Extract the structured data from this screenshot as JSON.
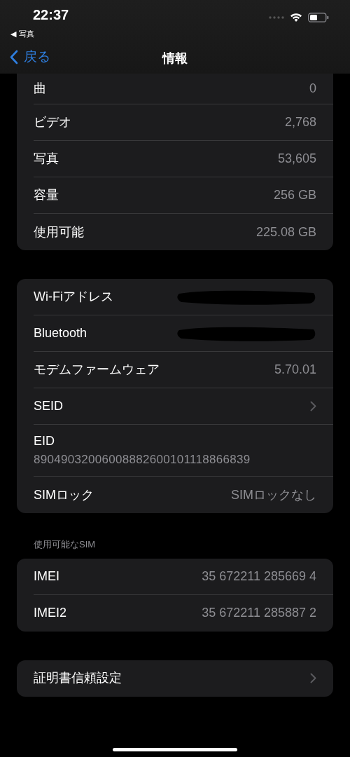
{
  "status_bar": {
    "time": "22:37",
    "back_app": "◀ 写真"
  },
  "nav": {
    "back": "戻る",
    "title": "情報"
  },
  "groups": [
    {
      "rows": [
        {
          "kind": "value",
          "label": "曲",
          "value": "0"
        },
        {
          "kind": "value",
          "label": "ビデオ",
          "value": "2,768"
        },
        {
          "kind": "value",
          "label": "写真",
          "value": "53,605"
        },
        {
          "kind": "value",
          "label": "容量",
          "value": "256 GB"
        },
        {
          "kind": "value",
          "label": "使用可能",
          "value": "225.08 GB"
        }
      ]
    },
    {
      "rows": [
        {
          "kind": "redacted",
          "label": "Wi-Fiアドレス"
        },
        {
          "kind": "redacted",
          "label": "Bluetooth"
        },
        {
          "kind": "value",
          "label": "モデムファームウェア",
          "value": "5.70.01"
        },
        {
          "kind": "link",
          "label": "SEID"
        },
        {
          "kind": "stacked",
          "label": "EID",
          "value": "89049032006008882600101118866839"
        },
        {
          "kind": "value",
          "label": "SIMロック",
          "value": "SIMロックなし"
        }
      ]
    },
    {
      "header": "使用可能なSIM",
      "rows": [
        {
          "kind": "value",
          "label": "IMEI",
          "value": "35 672211 285669 4"
        },
        {
          "kind": "value",
          "label": "IMEI2",
          "value": "35 672211 285887 2"
        }
      ]
    },
    {
      "rows": [
        {
          "kind": "link",
          "label": "証明書信頼設定"
        }
      ]
    }
  ]
}
